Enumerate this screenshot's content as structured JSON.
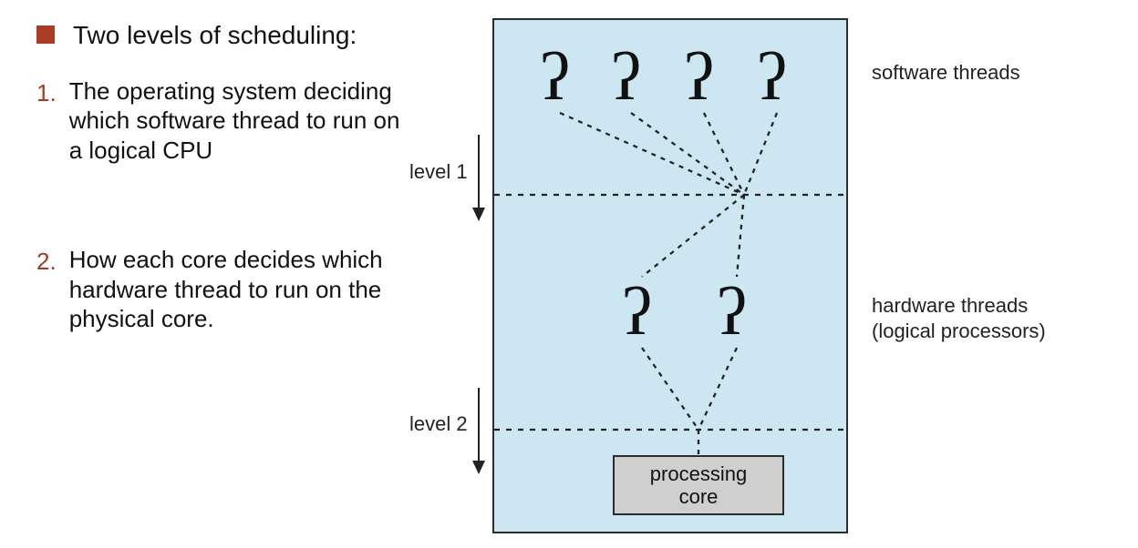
{
  "text": {
    "heading": "Two levels of scheduling:",
    "items": [
      {
        "marker": "1.",
        "body": "The operating system deciding which software thread to run on a logical CPU"
      },
      {
        "marker": "2.",
        "body": "How each core decides which hardware thread to run on the physical core."
      }
    ]
  },
  "diagram": {
    "level1_label": "level 1",
    "level2_label": "level 2",
    "software_label": "software threads",
    "hardware_label_line1": "hardware threads",
    "hardware_label_line2": "(logical processors)",
    "core_line1": "processing",
    "core_line2": "core"
  }
}
